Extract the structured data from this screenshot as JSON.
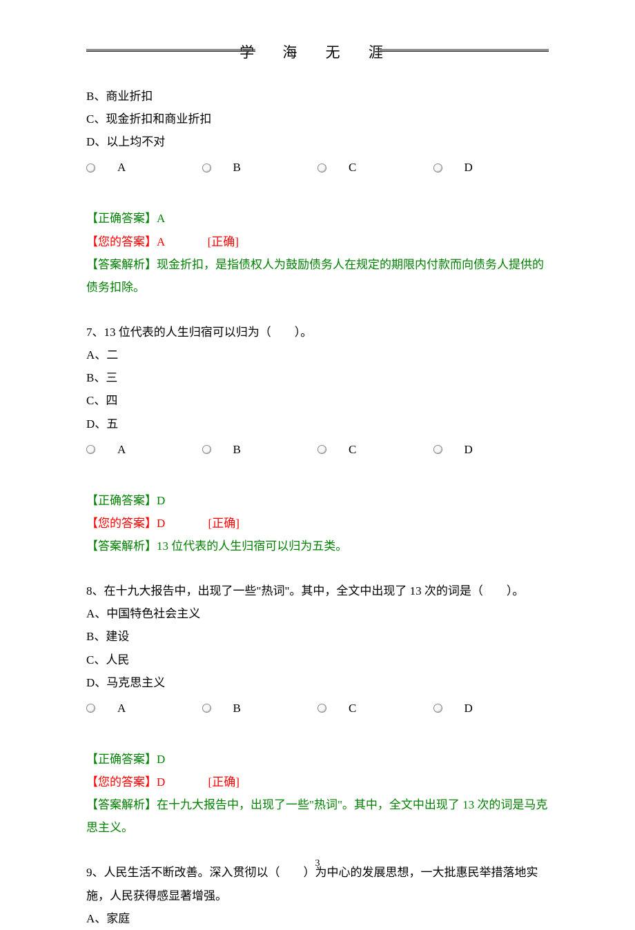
{
  "header": {
    "title": "学 海 无 涯"
  },
  "q6": {
    "optB": "B、商业折扣",
    "optC": "C、现金折扣和商业折扣",
    "optD": "D、以上均不对",
    "radios": {
      "a": "A",
      "b": "B",
      "c": "C",
      "d": "D"
    },
    "correct_label": "【正确答案】A",
    "your_label": "【您的答案】A",
    "status": "[正确]",
    "explanation": "【答案解析】现金折扣，是指债权人为鼓励债务人在规定的期限内付款而向债务人提供的债务扣除。"
  },
  "q7": {
    "question": "7、13 位代表的人生归宿可以归为（　　）。",
    "optA": "A、二",
    "optB": "B、三",
    "optC": "C、四",
    "optD": "D、五",
    "radios": {
      "a": "A",
      "b": "B",
      "c": "C",
      "d": "D"
    },
    "correct_label": "【正确答案】D",
    "your_label": "【您的答案】D",
    "status": "[正确]",
    "explanation": "【答案解析】13 位代表的人生归宿可以归为五类。"
  },
  "q8": {
    "question": "8、在十九大报告中，出现了一些\"热词\"。其中，全文中出现了 13 次的词是（　　）。",
    "optA": "A、中国特色社会主义",
    "optB": "B、建设",
    "optC": "C、人民",
    "optD": "D、马克思主义",
    "radios": {
      "a": "A",
      "b": "B",
      "c": "C",
      "d": "D"
    },
    "correct_label": "【正确答案】D",
    "your_label": "【您的答案】D",
    "status": "[正确]",
    "explanation": "【答案解析】在十九大报告中，出现了一些\"热词\"。其中，全文中出现了 13 次的词是马克思主义。"
  },
  "q9": {
    "question": "9、人民生活不断改善。深入贯彻以（　　）为中心的发展思想，一大批惠民举措落地实施，人民获得感显著增强。",
    "optA": "A、家庭"
  },
  "page_number": "3"
}
